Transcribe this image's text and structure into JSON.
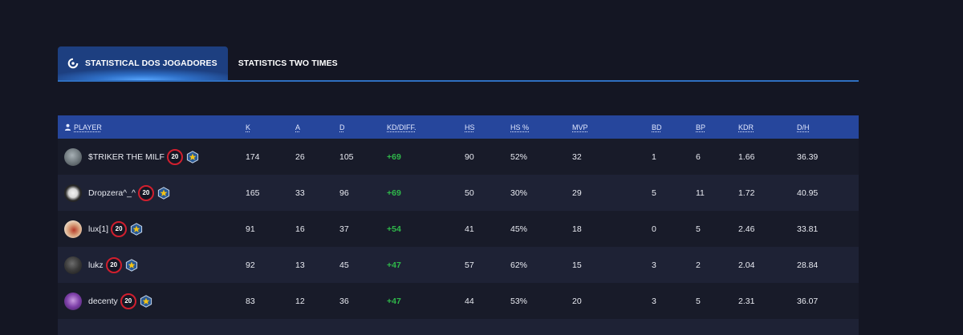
{
  "tabs": [
    {
      "label": "STATISTICAL DOS JOGADORES",
      "active": true
    },
    {
      "label": "STATISTICS TWO TIMES",
      "active": false
    }
  ],
  "table": {
    "headers": [
      "PLAYER",
      "K",
      "A",
      "D",
      "KD/DIFF.",
      "HS",
      "HS %",
      "MVP",
      "BD",
      "BP",
      "KDR",
      "D/H"
    ],
    "rows": [
      {
        "player": "$TRIKER THE MILF",
        "level": "20",
        "k": "174",
        "a": "26",
        "d": "105",
        "kd": "+69",
        "hs": "90",
        "hsp": "52%",
        "mvp": "32",
        "bd": "1",
        "bp": "6",
        "kdr": "1.66",
        "dh": "36.39"
      },
      {
        "player": "Dropzera^_^",
        "level": "20",
        "k": "165",
        "a": "33",
        "d": "96",
        "kd": "+69",
        "hs": "50",
        "hsp": "30%",
        "mvp": "29",
        "bd": "5",
        "bp": "11",
        "kdr": "1.72",
        "dh": "40.95"
      },
      {
        "player": "lux[1]",
        "level": "20",
        "k": "91",
        "a": "16",
        "d": "37",
        "kd": "+54",
        "hs": "41",
        "hsp": "45%",
        "mvp": "18",
        "bd": "0",
        "bp": "5",
        "kdr": "2.46",
        "dh": "33.81"
      },
      {
        "player": "lukz",
        "level": "20",
        "k": "92",
        "a": "13",
        "d": "45",
        "kd": "+47",
        "hs": "57",
        "hsp": "62%",
        "mvp": "15",
        "bd": "3",
        "bp": "2",
        "kdr": "2.04",
        "dh": "28.84"
      },
      {
        "player": "decenty",
        "level": "20",
        "k": "83",
        "a": "12",
        "d": "36",
        "kd": "+47",
        "hs": "44",
        "hsp": "53%",
        "mvp": "20",
        "bd": "3",
        "bp": "5",
        "kdr": "2.31",
        "dh": "36.07"
      }
    ]
  },
  "colors": {
    "background": "#141623",
    "header": "#26469c",
    "accent": "#2f6fc0",
    "kd_positive": "#2fb84a",
    "level_ring": "#d11f2e"
  },
  "icons": [
    "refresh-icon",
    "person-icon",
    "level-badge-icon",
    "star-badge-icon"
  ]
}
